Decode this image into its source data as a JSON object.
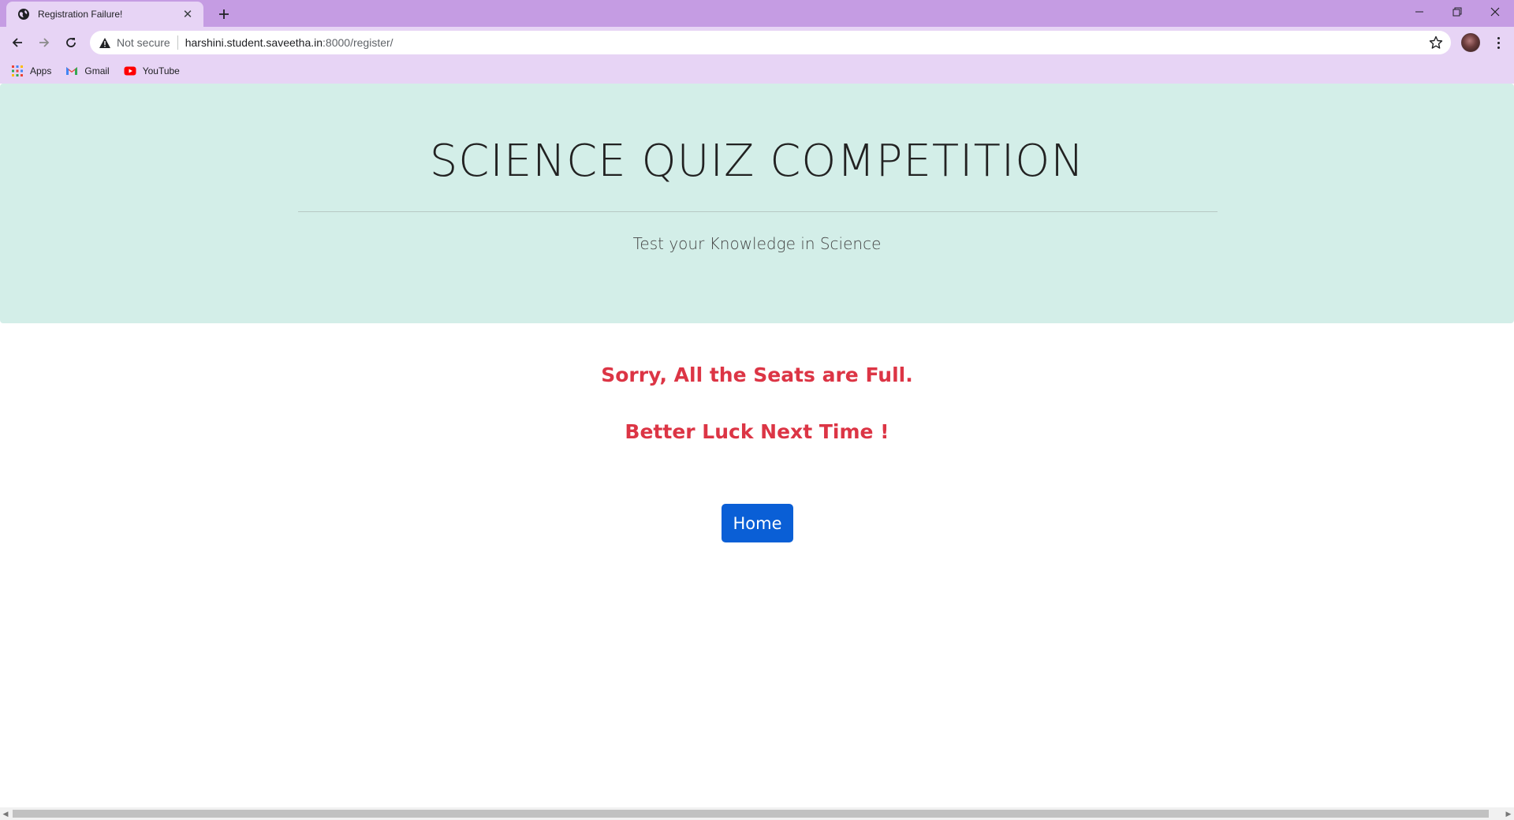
{
  "browser": {
    "tab": {
      "title": "Registration Failure!",
      "close_icon": "close-icon",
      "favicon": "globe-icon"
    },
    "new_tab_icon": "plus-icon",
    "window_controls": [
      "minimize-icon",
      "restore-icon",
      "close-icon"
    ],
    "address_bar": {
      "security_label": "Not secure",
      "host": "harshini.student.saveetha.in",
      "path": ":8000/register/",
      "star_icon": "star-icon"
    },
    "bookmarks": [
      {
        "label": "Apps",
        "icon": "apps-grid-icon"
      },
      {
        "label": "Gmail",
        "icon": "gmail-icon"
      },
      {
        "label": "YouTube",
        "icon": "youtube-icon"
      }
    ]
  },
  "page": {
    "jumbotron": {
      "title": "SCIENCE QUIZ COMPETITION",
      "lead": "Test your Knowledge in Science"
    },
    "messages": {
      "line1": "Sorry, All the Seats are Full.",
      "line2": "Better Luck Next Time !"
    },
    "home_button": "Home"
  },
  "colors": {
    "tabstrip": "#c59ce3",
    "toolbar": "#e7d4f5",
    "jumbotron_bg": "#d3eee8",
    "error_text": "#dc3545",
    "button_bg": "#0a5fd6"
  }
}
